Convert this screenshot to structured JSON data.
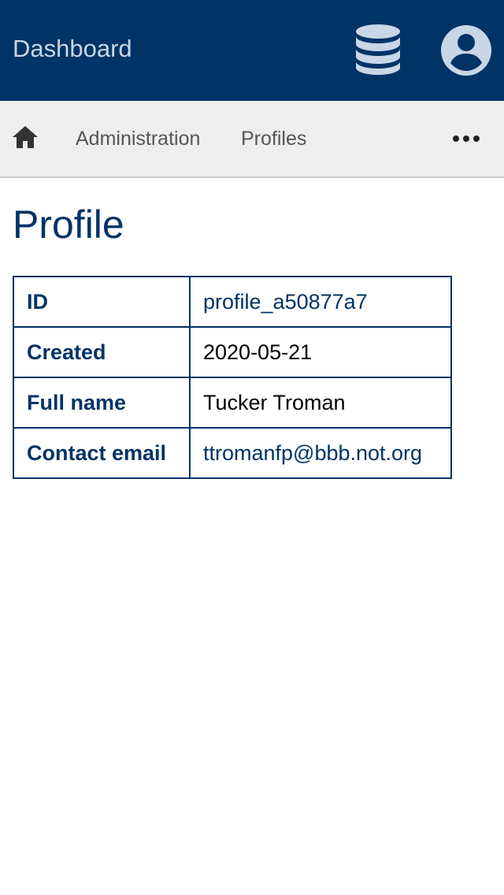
{
  "header": {
    "title": "Dashboard",
    "database_icon": "database-icon",
    "user_icon": "user-account-icon"
  },
  "nav": {
    "home_icon": "home-icon",
    "items": [
      {
        "label": "Administration"
      },
      {
        "label": "Profiles"
      }
    ],
    "more_icon": "more-horizontal-icon"
  },
  "page": {
    "title": "Profile"
  },
  "profile": {
    "rows": [
      {
        "label": "ID",
        "value": "profile_a50877a7"
      },
      {
        "label": "Created",
        "value": "2020-05-21"
      },
      {
        "label": "Full name",
        "value": "Tucker Troman"
      },
      {
        "label": "Contact email",
        "value": "ttromanfp@bbb.not.org"
      }
    ]
  },
  "colors": {
    "primary": "#003366",
    "header_text": "#c8d6e6",
    "nav_bg": "#eeeeee",
    "nav_text": "#555555",
    "icon_fill": "#c8d6e6"
  }
}
